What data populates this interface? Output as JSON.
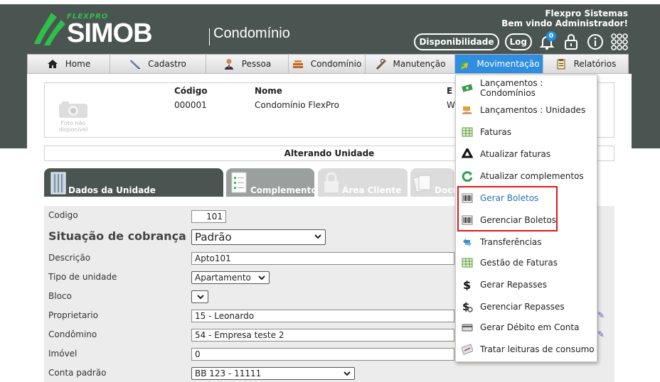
{
  "header": {
    "brand_small": "FLEXPRO",
    "brand_big": "SIMOB",
    "brand_module": "Condomínio",
    "company": "Flexpro Sistemas",
    "welcome": "Bem vindo Administrador!",
    "availability_button": "Disponibilidade",
    "log_button": "Log",
    "notification_count": "0",
    "colors": {
      "band": "#4a5552",
      "brand_green": "#2fc04a",
      "accent": "#2f8ee0"
    }
  },
  "nav": {
    "items": [
      {
        "label": "Home",
        "icon": "home-icon"
      },
      {
        "label": "Cadastro",
        "icon": "pen-icon"
      },
      {
        "label": "Pessoa",
        "icon": "person-icon"
      },
      {
        "label": "Condomínio",
        "icon": "buildings-icon"
      },
      {
        "label": "Manutenção",
        "icon": "tools-icon"
      },
      {
        "label": "Movimentação",
        "icon": "transfer-icon",
        "active": true
      },
      {
        "label": "Relatórios",
        "icon": "report-icon"
      }
    ]
  },
  "unit": {
    "headers": {
      "code": "Código",
      "name": "Nome",
      "email": "E"
    },
    "code": "000001",
    "name": "Condomínio FlexPro",
    "email": "W",
    "photo_placeholder_line1": "Foto não",
    "photo_placeholder_line2": "disponível"
  },
  "section_title": "Alterando Unidade",
  "tabs": [
    {
      "label": "Dados da Unidade",
      "active": true
    },
    {
      "label": "Complementos"
    },
    {
      "label": "Área Cliente"
    },
    {
      "label": "Docu"
    }
  ],
  "form": {
    "codigo_label": "Codigo",
    "codigo_value": "101",
    "situacao_label": "Situação de cobrança",
    "situacao_value": "Padrão",
    "descricao_label": "Descrição",
    "descricao_value": "Apto101",
    "tipo_label": "Tipo de unidade",
    "tipo_value": "Apartamento",
    "bloco_label": "Bloco",
    "bloco_value": "",
    "proprietario_label": "Proprietario",
    "proprietario_value": "15 - Leonardo",
    "condomino_label": "Condômino",
    "condomino_value": "54 - Empresa teste 2",
    "imovel_label": "Imóvel",
    "imovel_value": "0",
    "conta_label": "Conta padrão",
    "conta_value": "BB 123 - 11111"
  },
  "dropdown": {
    "items": [
      {
        "label": "Lançamentos : Condomínios",
        "icon": "money-icon"
      },
      {
        "label": "Lançamentos : Unidades",
        "icon": "hand-money-icon"
      },
      {
        "label": "Faturas",
        "icon": "spreadsheet-icon"
      },
      {
        "label": "Atualizar faturas",
        "icon": "recycle-icon"
      },
      {
        "label": "Atualizar complementos",
        "icon": "refresh-icon"
      },
      {
        "label": "Gerar Boletos",
        "icon": "barcode-icon",
        "highlighted": true
      },
      {
        "label": "Gerenciar Boletos",
        "icon": "barcode-icon",
        "highlighted": true
      },
      {
        "label": "Transferências",
        "icon": "transfer-icon"
      },
      {
        "label": "Gestão de Faturas",
        "icon": "spreadsheet-icon"
      },
      {
        "label": "Gerar Repasses",
        "icon": "dollar-icon"
      },
      {
        "label": "Gerenciar Repasses",
        "icon": "dollar-gear-icon"
      },
      {
        "label": "Gerar Débito em Conta",
        "icon": "card-icon"
      },
      {
        "label": "Tratar leituras de consumo",
        "icon": "meter-icon"
      }
    ]
  }
}
